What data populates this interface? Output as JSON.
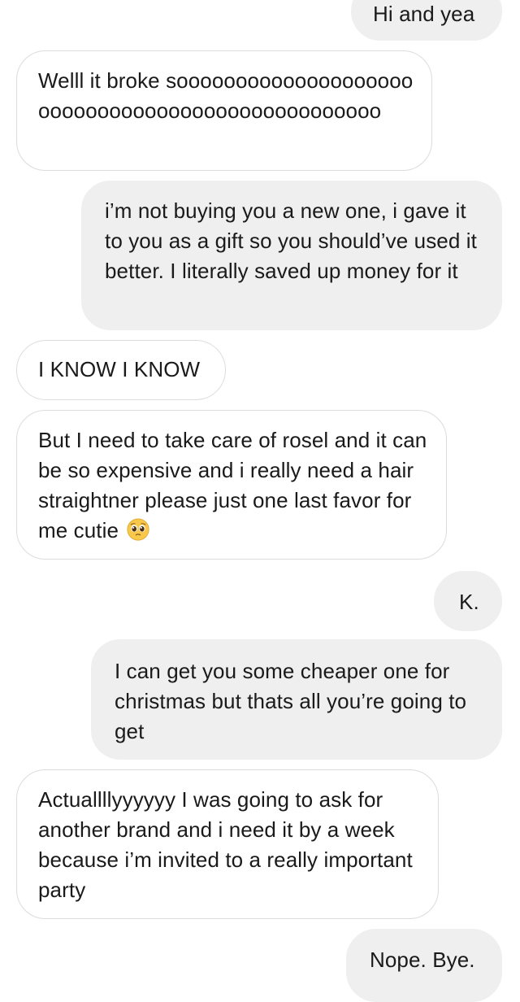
{
  "conversation": {
    "messages": [
      {
        "id": "m1",
        "sender": "me",
        "text": "Hi and yea"
      },
      {
        "id": "m2",
        "sender": "them",
        "text": "Welll it broke sooooooooooooooooooooooooooooooooooooooooooooooooo"
      },
      {
        "id": "m3",
        "sender": "me",
        "text": "i’m not buying you a new one, i gave it to you as a gift so you should’ve used it better. I literally saved up money for it"
      },
      {
        "id": "m4",
        "sender": "them",
        "text": "I KNOW I KNOW"
      },
      {
        "id": "m5",
        "sender": "them",
        "text": "But I need to take care of rosel and it can be so expensive and i really need a hair straightner please just one last favor for me cutie",
        "emoji": "pleading-face"
      },
      {
        "id": "m6",
        "sender": "me",
        "text": "K."
      },
      {
        "id": "m7",
        "sender": "me",
        "text": "I can get you some cheaper one for christmas but thats all you’re going to get"
      },
      {
        "id": "m8",
        "sender": "them",
        "text": "Actuallllyyyyyy I was going to ask for another brand and i need it by a week because i’m invited to a really important party"
      },
      {
        "id": "m9",
        "sender": "me",
        "text": "Nope. Bye."
      }
    ]
  },
  "colors": {
    "sent_bubble": "#efefef",
    "received_bubble": "#ffffff",
    "received_border": "#dcdcdc",
    "text": "#1a1a1a"
  }
}
